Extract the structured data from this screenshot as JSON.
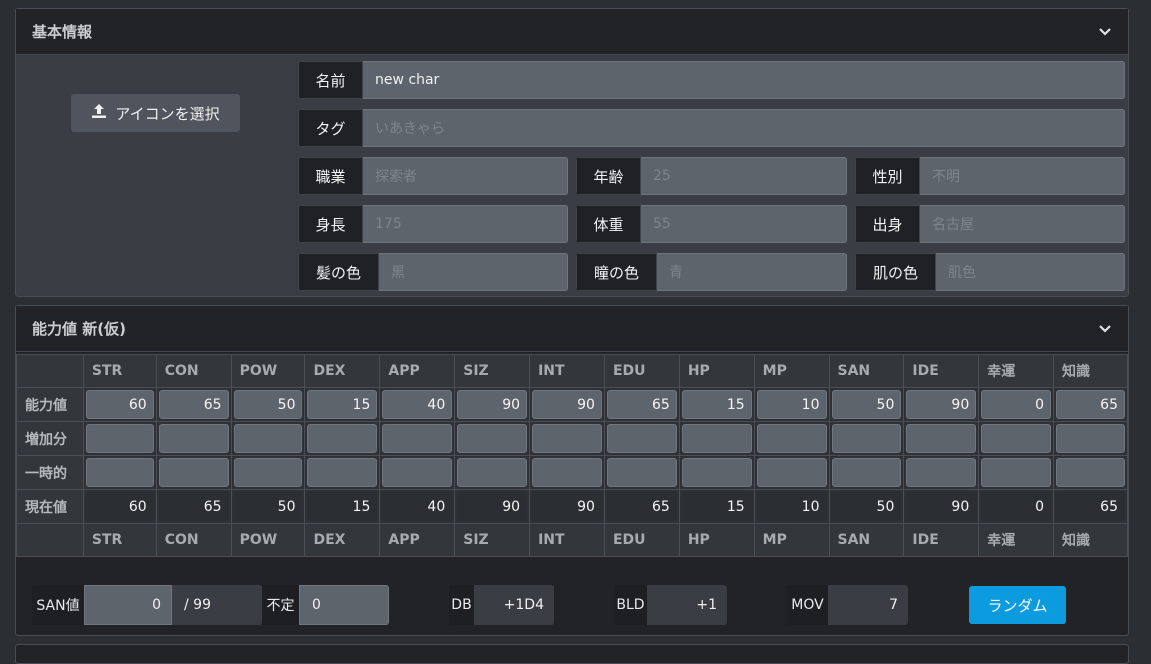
{
  "basic": {
    "title": "基本情報",
    "icon_button": "アイコンを選択",
    "name": {
      "label": "名前",
      "value": "new char"
    },
    "tag": {
      "label": "タグ",
      "placeholder": "いあきゃら"
    },
    "job": {
      "label": "職業",
      "placeholder": "探索者"
    },
    "age": {
      "label": "年齢",
      "placeholder": "25"
    },
    "sex": {
      "label": "性別",
      "placeholder": "不明"
    },
    "height": {
      "label": "身長",
      "placeholder": "175"
    },
    "weight": {
      "label": "体重",
      "placeholder": "55"
    },
    "origin": {
      "label": "出身",
      "placeholder": "名古屋"
    },
    "hair": {
      "label": "髪の色",
      "placeholder": "黒"
    },
    "eye": {
      "label": "瞳の色",
      "placeholder": "青"
    },
    "skin": {
      "label": "肌の色",
      "placeholder": "肌色"
    }
  },
  "abilities": {
    "title": "能力値 新(仮)",
    "columns": [
      "STR",
      "CON",
      "POW",
      "DEX",
      "APP",
      "SIZ",
      "INT",
      "EDU",
      "HP",
      "MP",
      "SAN",
      "IDE",
      "幸運",
      "知識"
    ],
    "rows": {
      "base": {
        "label": "能力値",
        "values": [
          "60",
          "65",
          "50",
          "15",
          "40",
          "90",
          "90",
          "65",
          "15",
          "10",
          "50",
          "90",
          "0",
          "65"
        ]
      },
      "inc": {
        "label": "増加分",
        "values": [
          "",
          "",
          "",
          "",
          "",
          "",
          "",
          "",
          "",
          "",
          "",
          "",
          "",
          ""
        ]
      },
      "temp": {
        "label": "一時的",
        "values": [
          "",
          "",
          "",
          "",
          "",
          "",
          "",
          "",
          "",
          "",
          "",
          "",
          "",
          ""
        ]
      },
      "cur": {
        "label": "現在値",
        "values": [
          "60",
          "65",
          "50",
          "15",
          "40",
          "90",
          "90",
          "65",
          "15",
          "10",
          "50",
          "90",
          "0",
          "65"
        ]
      }
    },
    "san": {
      "label": "SAN値",
      "value": "0",
      "max": "/ 99"
    },
    "indef": {
      "label": "不定",
      "value": "0"
    },
    "db": {
      "label": "DB",
      "value": "+1D4"
    },
    "bld": {
      "label": "BLD",
      "value": "+1"
    },
    "mov": {
      "label": "MOV",
      "value": "7"
    },
    "random_button": "ランダム"
  }
}
